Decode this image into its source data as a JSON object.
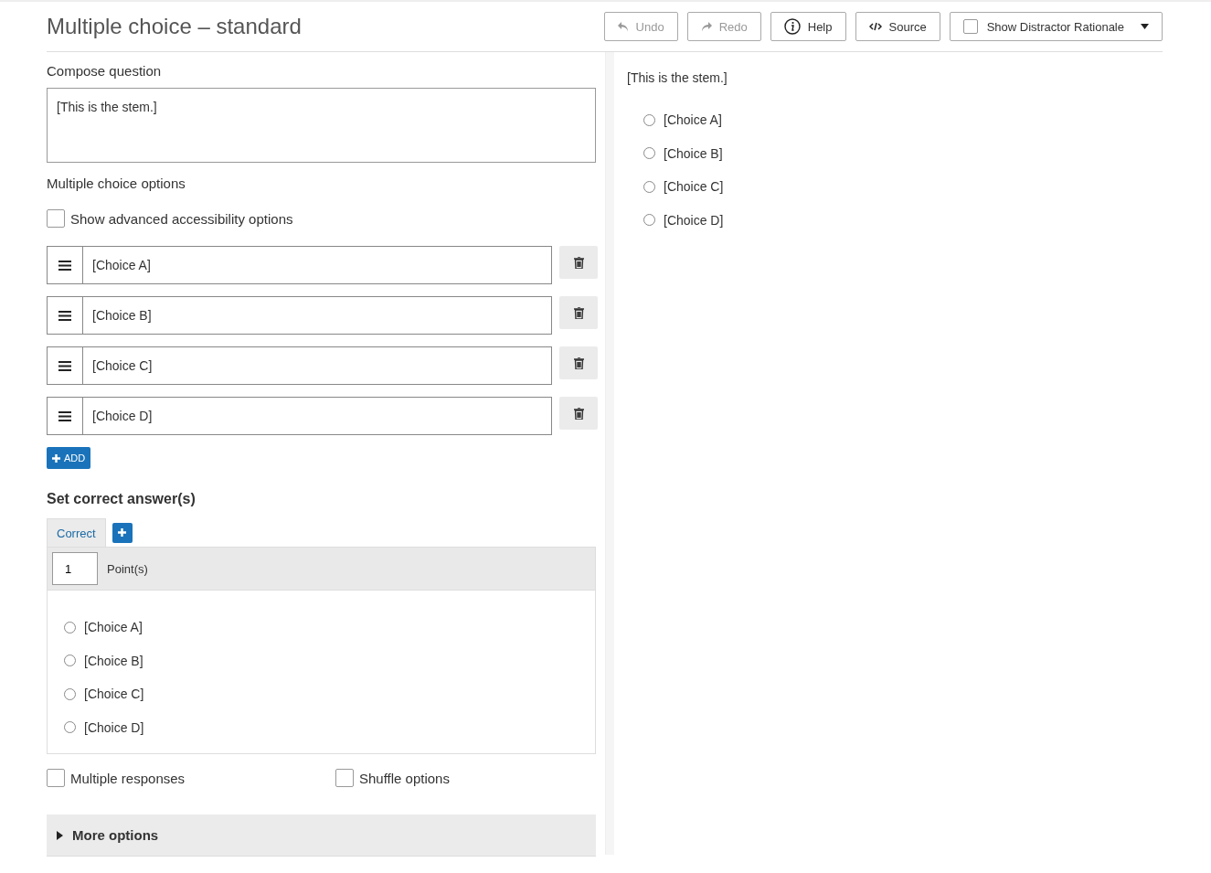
{
  "header": {
    "title": "Multiple choice – standard",
    "toolbar": [
      {
        "kind": "undo",
        "label": "Undo",
        "disabled": true
      },
      {
        "kind": "redo",
        "label": "Redo",
        "disabled": true
      },
      {
        "kind": "help",
        "label": "Help",
        "disabled": false
      },
      {
        "kind": "source",
        "label": "Source",
        "disabled": false
      },
      {
        "kind": "toggle",
        "label": "Show Distractor Rationale",
        "checked": false
      }
    ]
  },
  "compose": {
    "heading": "Compose question",
    "stem": "[This is the stem.]"
  },
  "options_section": {
    "heading": "Multiple choice options",
    "accessibility": {
      "label": "Show advanced accessibility options",
      "checked": false
    },
    "options": [
      "[Choice A]",
      "[Choice B]",
      "[Choice C]",
      "[Choice D]"
    ],
    "add_label": "ADD"
  },
  "correct_section": {
    "heading": "Set correct answer(s)",
    "tabs": [
      {
        "label": "Correct",
        "selected": true
      }
    ],
    "points": "1",
    "points_label": "Point(s)",
    "answers": [
      {
        "label": "[Choice A]",
        "selected": false
      },
      {
        "label": "[Choice B]",
        "selected": false
      },
      {
        "label": "[Choice C]",
        "selected": false
      },
      {
        "label": "[Choice D]",
        "selected": false
      }
    ]
  },
  "settings": [
    {
      "label": "Multiple responses",
      "checked": false
    },
    {
      "label": "Shuffle options",
      "checked": false
    }
  ],
  "more_options": {
    "label": "More options",
    "expanded": false
  },
  "preview": {
    "stem": "[This is the stem.]",
    "choices": [
      {
        "label": "[Choice A]",
        "selected": false
      },
      {
        "label": "[Choice B]",
        "selected": false
      },
      {
        "label": "[Choice C]",
        "selected": false
      },
      {
        "label": "[Choice D]",
        "selected": false
      }
    ]
  }
}
